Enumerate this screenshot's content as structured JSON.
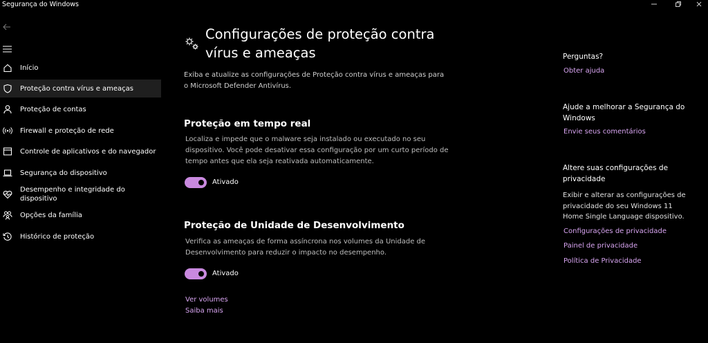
{
  "window": {
    "title": "Segurança do Windows"
  },
  "nav": {
    "items": [
      {
        "label": "Início"
      },
      {
        "label": "Proteção contra vírus e ameaças"
      },
      {
        "label": "Proteção de contas"
      },
      {
        "label": "Firewall e proteção de rede"
      },
      {
        "label": "Controle de aplicativos e do navegador"
      },
      {
        "label": "Segurança do dispositivo"
      },
      {
        "label": "Desempenho e integridade do dispositivo"
      },
      {
        "label": "Opções da família"
      },
      {
        "label": "Histórico de proteção"
      }
    ]
  },
  "main": {
    "title": "Configurações de proteção contra vírus e ameaças",
    "description": "Exiba e atualize as configurações de Proteção contra vírus e ameaças para o Microsoft Defender Antivírus.",
    "realtime": {
      "title": "Proteção em tempo real",
      "text": "Localiza e impede que o malware seja instalado ou executado no seu dispositivo. Você pode desativar essa configuração por um curto período de tempo antes que ela seja reativada automaticamente.",
      "toggle_label": "Ativado",
      "enabled": true
    },
    "devdrive": {
      "title": "Proteção de Unidade de Desenvolvimento",
      "text": "Verifica as ameaças de forma assíncrona nos volumes da Unidade de Desenvolvimento para reduzir o impacto no desempenho.",
      "toggle_label": "Ativado",
      "enabled": true,
      "link_volumes": "Ver volumes",
      "link_learn": "Saiba mais"
    }
  },
  "side": {
    "questions_title": "Perguntas?",
    "get_help": "Obter ajuda",
    "improve_title": "Ajude a melhorar a Segurança do Windows",
    "feedback": "Envie seus comentários",
    "privacy_title": "Altere suas configurações de privacidade",
    "privacy_text": "Exibir e alterar as configurações de privacidade do seu Windows 11 Home Single Language dispositivo.",
    "privacy_settings": "Configurações de privacidade",
    "privacy_dashboard": "Painel de privacidade",
    "privacy_policy": "Política de Privacidade"
  },
  "colors": {
    "accent": "#c989df",
    "link": "#d7a4f0",
    "background": "#000000"
  }
}
